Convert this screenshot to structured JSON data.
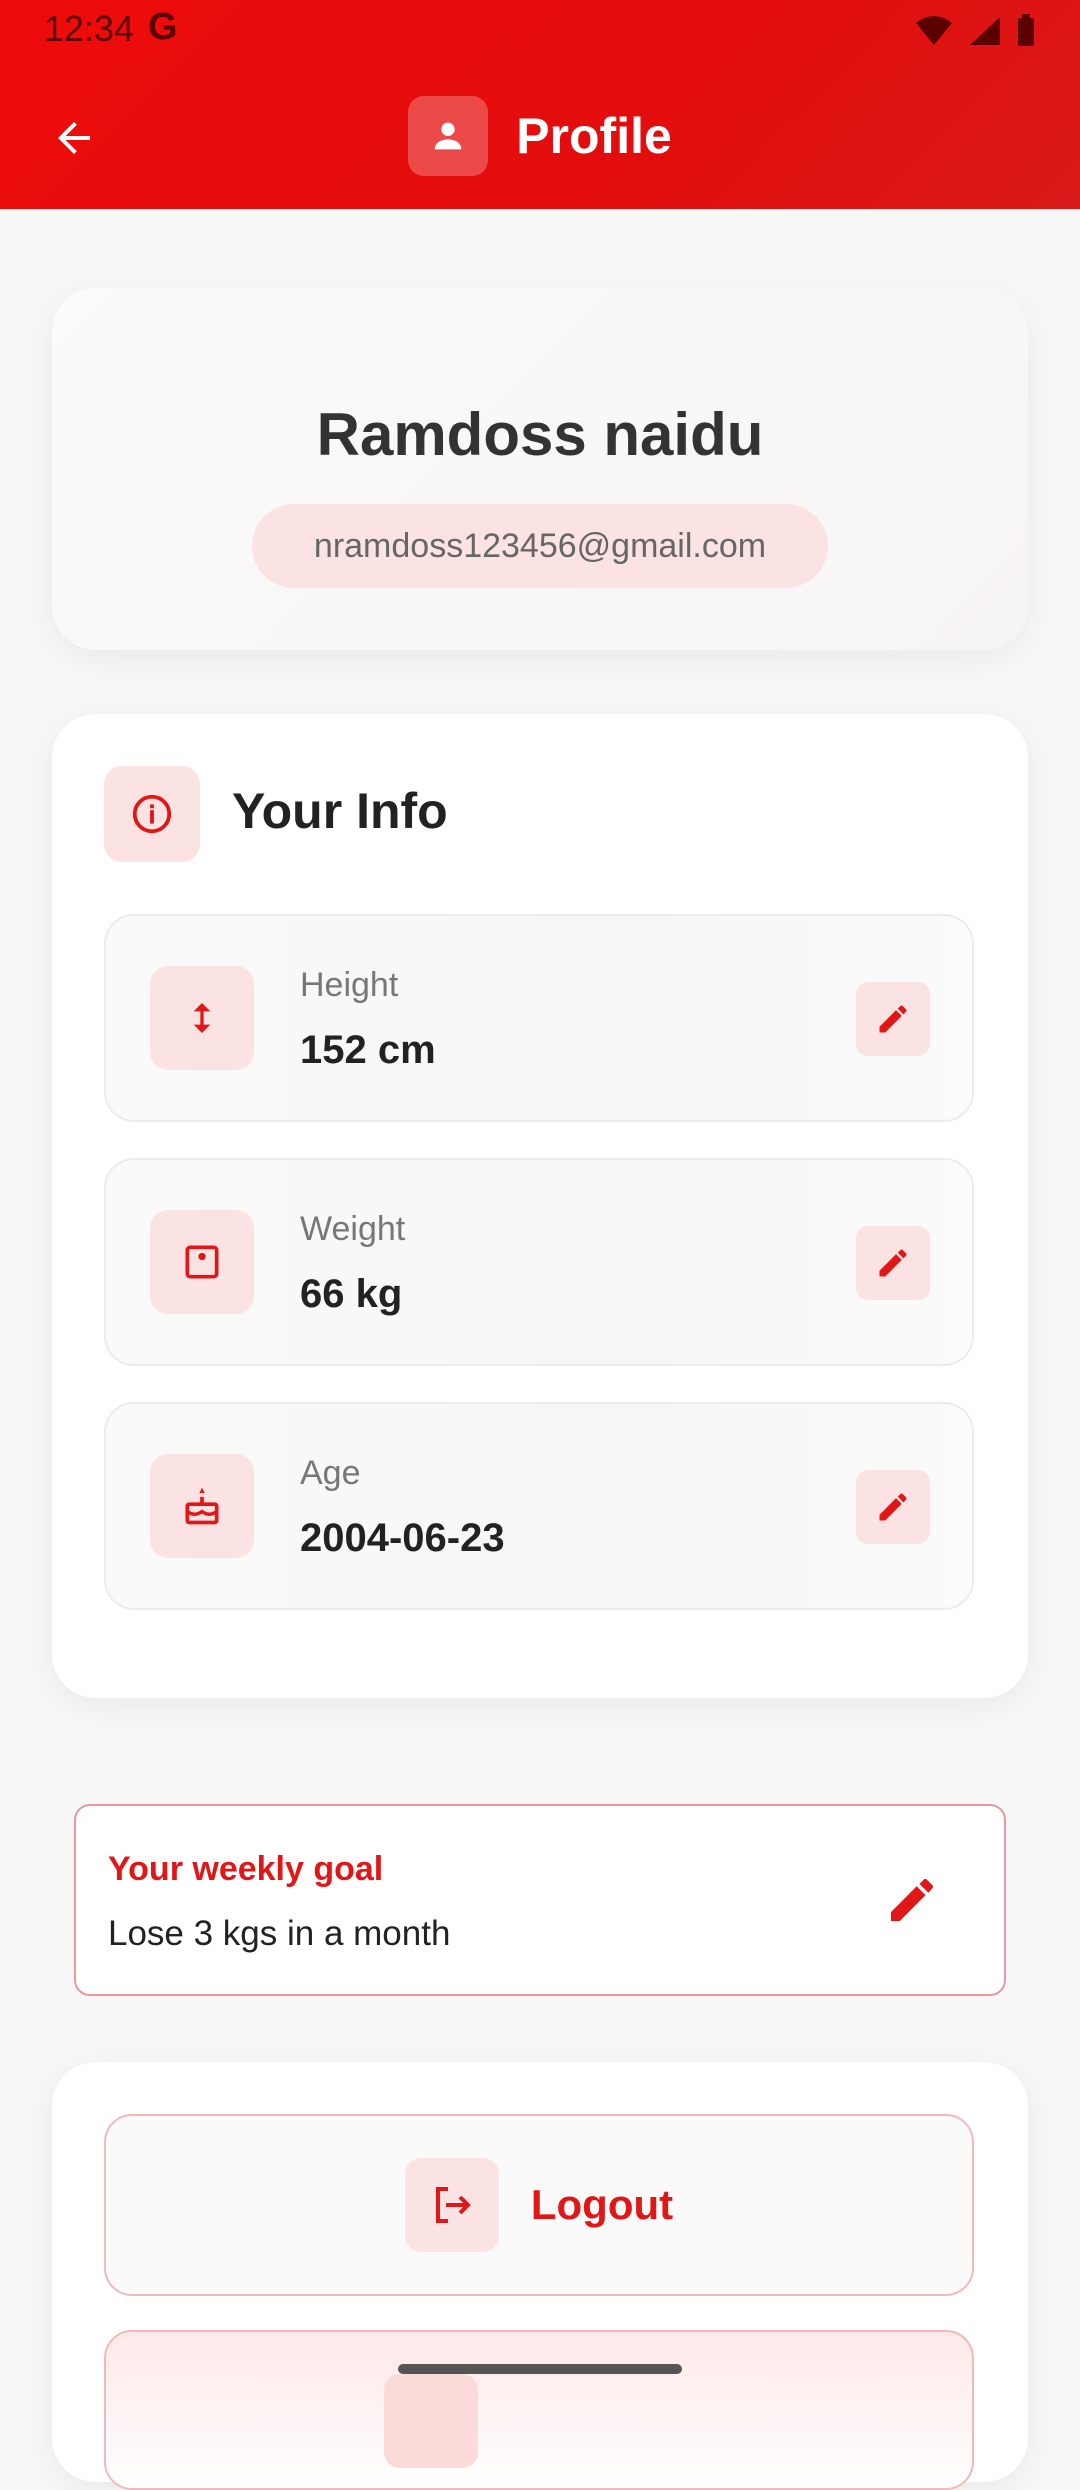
{
  "status_bar": {
    "time": "12:34",
    "g_logo": "G",
    "icons": [
      "wifi-icon",
      "signal-icon",
      "battery-icon"
    ]
  },
  "header": {
    "title": "Profile",
    "back_icon": "arrow-left-icon",
    "title_icon": "person-icon",
    "color": "#e30d0d"
  },
  "profile": {
    "name": "Ramdoss naidu",
    "email": "nramdoss123456@gmail.com"
  },
  "info": {
    "title": "Your Info",
    "icon": "info-icon",
    "items": [
      {
        "label": "Height",
        "value": "152 cm",
        "icon": "height-arrows-icon"
      },
      {
        "label": "Weight",
        "value": "66 kg",
        "icon": "scale-icon"
      },
      {
        "label": "Age",
        "value": "2004-06-23",
        "icon": "cake-icon"
      }
    ]
  },
  "goal": {
    "title": "Your weekly goal",
    "text": "Lose 3 kgs in a month",
    "icon": "edit-icon"
  },
  "actions": {
    "logout_label": "Logout",
    "logout_icon": "logout-icon"
  },
  "accent_color": "#e11616"
}
